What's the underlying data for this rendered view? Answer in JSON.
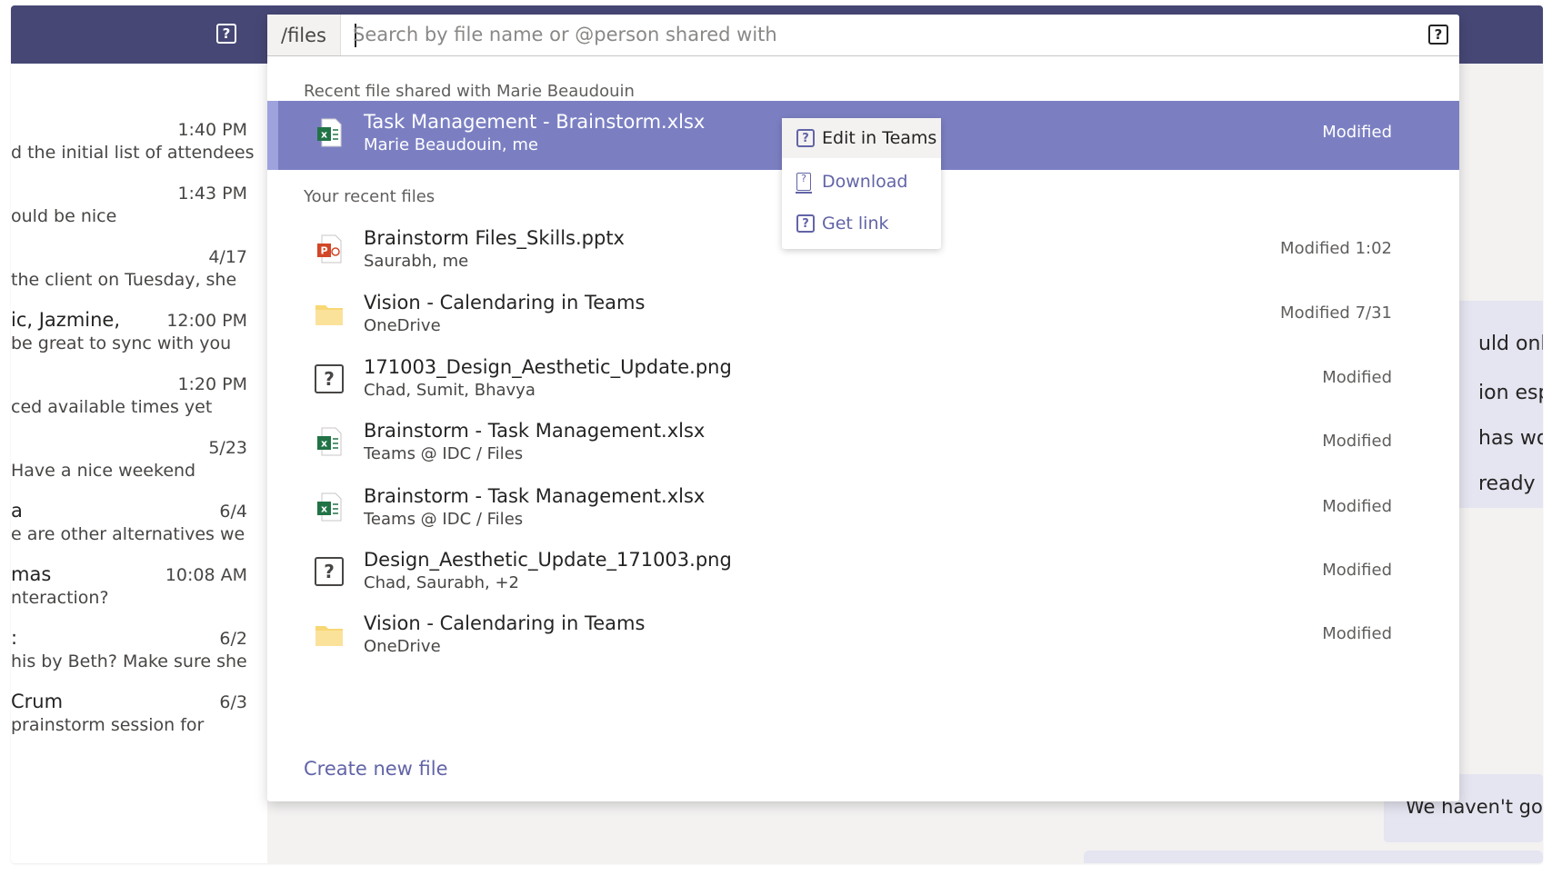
{
  "left_chats": [
    {
      "name": "",
      "time": "1:40 PM",
      "preview": "d the initial list of attendees"
    },
    {
      "name": "",
      "time": "1:43 PM",
      "preview": "ould be nice"
    },
    {
      "name": "",
      "time": "4/17",
      "preview": "the client on Tuesday, she"
    },
    {
      "name": "ic, Jazmine,",
      "time": "12:00 PM",
      "preview": "be great to sync with you"
    },
    {
      "name": "",
      "time": "1:20 PM",
      "preview": "ced available times yet"
    },
    {
      "name": "",
      "time": "5/23",
      "preview": "Have a nice weekend"
    },
    {
      "name": "a",
      "time": "6/4",
      "preview": "e are other alternatives we"
    },
    {
      "name": "mas",
      "time": "10:08 AM",
      "preview": "nteraction?"
    },
    {
      "name": ":",
      "time": "6/2",
      "preview": "his by Beth? Make sure she"
    },
    {
      "name": "Crum",
      "time": "6/3",
      "preview": "prainstorm session for"
    }
  ],
  "right_pane": {
    "lines": [
      "uld only",
      "ion espe",
      "has work",
      "ready ur"
    ],
    "bottom_message": "We haven't gott"
  },
  "search": {
    "command": "/files",
    "placeholder": "Search by file name or @person shared with",
    "value": ""
  },
  "sections": {
    "shared": "Recent file shared with Marie Beaudouin",
    "recent": "Your recent files"
  },
  "shared_file": {
    "title": "Task Management - Brainstorm.xlsx",
    "sub": "Marie Beaudouin, me",
    "modified": "Modified",
    "icon": "excel-icon"
  },
  "recent_files": [
    {
      "title": "Brainstorm Files_Skills.pptx",
      "sub": "Saurabh, me",
      "modified": "Modified 1:02",
      "icon": "powerpoint-icon"
    },
    {
      "title": "Vision - Calendaring in Teams",
      "sub": "OneDrive",
      "modified": "Modified 7/31",
      "icon": "folder-icon"
    },
    {
      "title": "171003_Design_Aesthetic_Update.png",
      "sub": "Chad, Sumit, Bhavya",
      "modified": "Modified",
      "icon": "unknown-file-icon"
    },
    {
      "title": "Brainstorm - Task Management.xlsx",
      "sub": "Teams @ IDC / Files",
      "modified": "Modified",
      "icon": "excel-icon"
    },
    {
      "title": "Brainstorm - Task Management.xlsx",
      "sub": "Teams @ IDC / Files",
      "modified": "Modified",
      "icon": "excel-icon"
    },
    {
      "title": "Design_Aesthetic_Update_171003.png",
      "sub": "Chad, Saurabh, +2",
      "modified": "Modified",
      "icon": "unknown-file-icon"
    },
    {
      "title": "Vision - Calendaring in Teams",
      "sub": "OneDrive",
      "modified": "Modified",
      "icon": "folder-icon"
    }
  ],
  "create_label": "Create new file",
  "context_menu": {
    "edit": "Edit in Teams",
    "download": "Download",
    "get_link": "Get link"
  },
  "colors": {
    "header": "#464775",
    "accent": "#6264a7",
    "highlight": "#7b7fc2",
    "excel": "#217346",
    "powerpoint": "#d24726",
    "folder": "#f8d775"
  }
}
